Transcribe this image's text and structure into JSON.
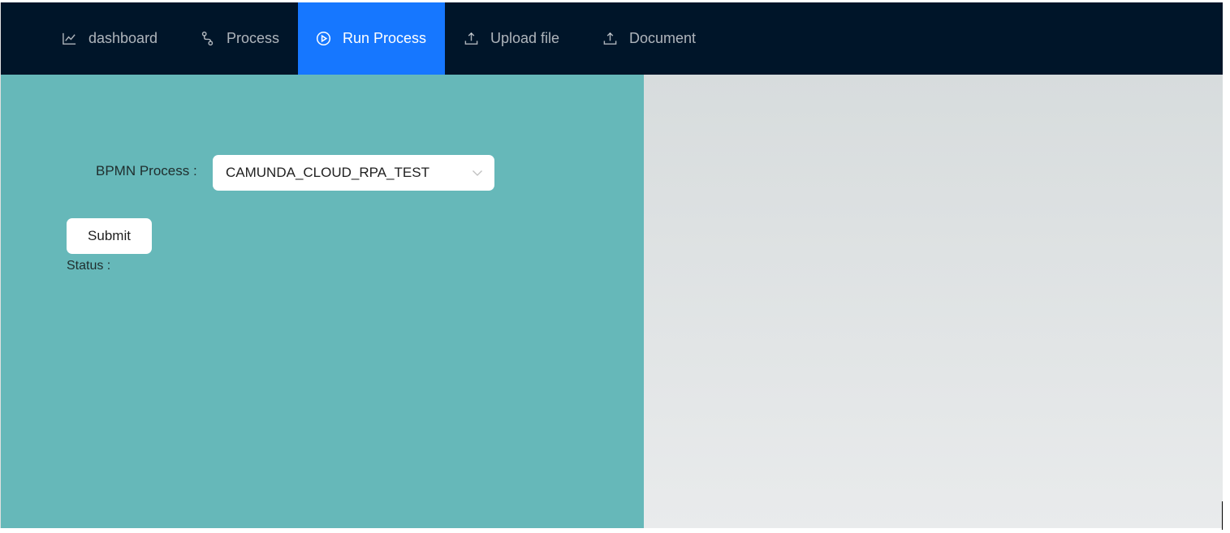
{
  "navbar": {
    "items": [
      {
        "label": "dashboard",
        "icon": "line-chart-icon"
      },
      {
        "label": "Process",
        "icon": "branches-icon"
      },
      {
        "label": "Run Process",
        "icon": "play-circle-icon",
        "active": true
      },
      {
        "label": "Upload file",
        "icon": "upload-icon"
      },
      {
        "label": "Document",
        "icon": "upload-icon"
      }
    ]
  },
  "form": {
    "process_label": "BPMN Process :",
    "process_value": "CAMUNDA_CLOUD_RPA_TEST",
    "submit_label": "Submit",
    "status_label": "Status :"
  },
  "colors": {
    "navbar_bg": "#001529",
    "active_tab": "#1677ff",
    "left_panel": "#66b8b9",
    "right_panel": "#dcdfe0"
  }
}
